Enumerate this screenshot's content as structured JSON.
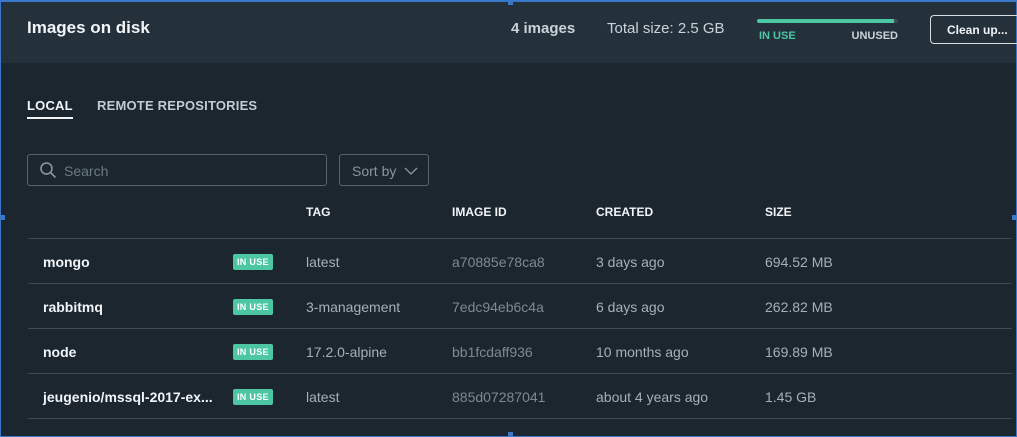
{
  "header": {
    "title": "Images on disk",
    "count": "4 images",
    "total_size": "Total size: 2.5 GB",
    "usage": {
      "in_use_label": "IN USE",
      "unused_label": "UNUSED",
      "in_use_fraction": 0.97
    },
    "cleanup_label": "Clean up..."
  },
  "tabs": {
    "local": "LOCAL",
    "remote": "REMOTE REPOSITORIES"
  },
  "search": {
    "placeholder": "Search",
    "value": ""
  },
  "sort": {
    "label": "Sort by"
  },
  "table": {
    "columns": {
      "tag": "TAG",
      "image_id": "IMAGE ID",
      "created": "CREATED",
      "size": "SIZE"
    },
    "rows": [
      {
        "name": "mongo",
        "badge": "IN USE",
        "tag": "latest",
        "image_id": "a70885e78ca8",
        "created": "3 days ago",
        "size": "694.52 MB"
      },
      {
        "name": "rabbitmq",
        "badge": "IN USE",
        "tag": "3-management",
        "image_id": "7edc94eb6c4a",
        "created": "6 days ago",
        "size": "262.82 MB"
      },
      {
        "name": "node",
        "badge": "IN USE",
        "tag": "17.2.0-alpine",
        "image_id": "bb1fcdaff936",
        "created": "10 months ago",
        "size": "169.89 MB"
      },
      {
        "name": "jeugenio/mssql-2017-ex...",
        "badge": "IN USE",
        "tag": "latest",
        "image_id": "885d07287041",
        "created": "about 4 years ago",
        "size": "1.45 GB"
      }
    ]
  },
  "colors": {
    "accent": "#4dc7a3",
    "background": "#1b262f",
    "header_bg": "#24313b"
  }
}
